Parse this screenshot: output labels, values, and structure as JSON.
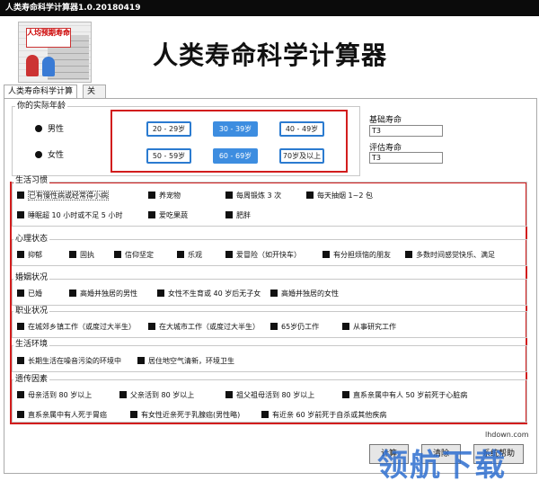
{
  "window": {
    "title": "人类寿命科学计算器1.0.20180419"
  },
  "header": {
    "title": "人类寿命科学计算器",
    "logo_text": "人均预期寿命"
  },
  "tabs": [
    {
      "label": "人类寿命科学计算器",
      "active": true
    },
    {
      "label": "关于",
      "active": false
    }
  ],
  "age_section": {
    "label": "你的实际年龄",
    "genders": [
      "男性",
      "女性"
    ],
    "age_buttons": [
      "20 - 29岁",
      "30 - 39岁",
      "40 - 49岁",
      "50 - 59岁",
      "60 - 69岁",
      "70岁及以上"
    ],
    "selected": [
      "30 - 39岁",
      "60 - 69岁"
    ]
  },
  "results": {
    "base_label": "基础寿命",
    "base_value": "T3",
    "eval_label": "评估寿命",
    "eval_value": "T3"
  },
  "sections": [
    {
      "label": "生活习惯",
      "items": [
        "已有慢性病或经常得小病",
        "养宠物",
        "每周锻炼 3 次",
        "每天抽烟 1~2 包",
        "睡眠超 10 小时或不足 5 小时",
        "爱吃果蔬",
        "肥胖"
      ]
    },
    {
      "label": "心理状态",
      "items": [
        "抑郁",
        "固执",
        "信仰坚定",
        "乐观",
        "爱冒险（如开快车）",
        "有分担烦恼的朋友",
        "多数时间感觉快乐、满足"
      ]
    },
    {
      "label": "婚姻状况",
      "items": [
        "已婚",
        "高婚并独居的男性",
        "女性不生育或 40 岁后无子女",
        "高婚并独居的女性"
      ]
    },
    {
      "label": "职业状况",
      "items": [
        "在城郊乡镇工作（或度过大半生）",
        "在大城市工作（或度过大半生）",
        "65岁仍工作",
        "从事研究工作"
      ]
    },
    {
      "label": "生活环境",
      "items": [
        "长期生活在噪音污染的环境中",
        "居住地空气清新，环境卫生"
      ]
    },
    {
      "label": "遗传因素",
      "items": [
        "母亲活到 80 岁以上",
        "父亲活到 80 岁以上",
        "祖父祖母活到 80 岁以上",
        "直系亲属中有人 50 岁前死于心脏病",
        "直系亲属中有人死于胃癌",
        "有女性近亲死于乳腺癌(男性略)",
        "有近亲 60 岁前死于自杀或其他疾病"
      ]
    }
  ],
  "bottom_buttons": [
    "计算",
    "清除",
    "系统帮助"
  ],
  "watermark": {
    "text": "领航下载",
    "url": "lhdown.com"
  },
  "colors": {
    "highlight": "#d21d1d",
    "accent": "#2b7bd0"
  }
}
